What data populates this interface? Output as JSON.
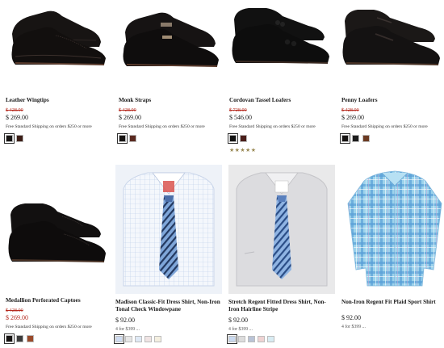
{
  "products": [
    {
      "title": "Leather Wingtips",
      "old_price": "$ 428.00",
      "price": "$ 269.00",
      "shipping": "Free Standard Shipping on orders $250 or more",
      "swatches": [
        "#171413",
        "#3b1d16"
      ]
    },
    {
      "title": "Monk Straps",
      "old_price": "$ 428.00",
      "price": "$ 269.00",
      "shipping": "Free Standard Shipping on orders $250 or more",
      "swatches": [
        "#171413",
        "#5a2a20"
      ]
    },
    {
      "title": "Cordovan Tassel Loafers",
      "old_price": "$ 728.00",
      "price": "$ 546.00",
      "shipping": "Free Standard Shipping on orders $250 or more",
      "swatches": [
        "#111111",
        "#4a1e1a"
      ],
      "rating": "★★★★★"
    },
    {
      "title": "Penny Loafers",
      "old_price": "$ 428.00",
      "price": "$ 269.00",
      "shipping": "Free Standard Shipping on orders $250 or more",
      "swatches": [
        "#171413",
        "#1c1c1c",
        "#6b3a22"
      ]
    },
    {
      "title": "Medallion Perforated Captoes",
      "old_price": "$ 428.00",
      "price": "$ 269.00",
      "shipping": "Free Standard Shipping on orders $250 or more",
      "swatches": [
        "#171413",
        "#3c3c3c",
        "#9a4a2a"
      ]
    },
    {
      "title": "Madison Classic-Fit Dress Shirt, Non-Iron Tonal Check Windowpane",
      "price": "$ 92.00",
      "promo": "4 for $399 ...",
      "swatches": [
        "#cfdcf2",
        "#e6e6e6",
        "#dfe9f5",
        "#f0e4e4",
        "#f4efe0"
      ]
    },
    {
      "title": "Stretch Regent Fitted Dress Shirt, Non-Iron Hairline Stripe",
      "price": "$ 92.00",
      "promo": "4 for $399 ...",
      "swatches": [
        "#c9d9ef",
        "#dcdcdc",
        "#b9c3d6",
        "#efd3d3",
        "#d8ecf3"
      ]
    },
    {
      "title": "Non-Iron Regent Fit Plaid Sport Shirt",
      "price": "$ 92.00",
      "promo": "4 for $399 ..."
    }
  ]
}
